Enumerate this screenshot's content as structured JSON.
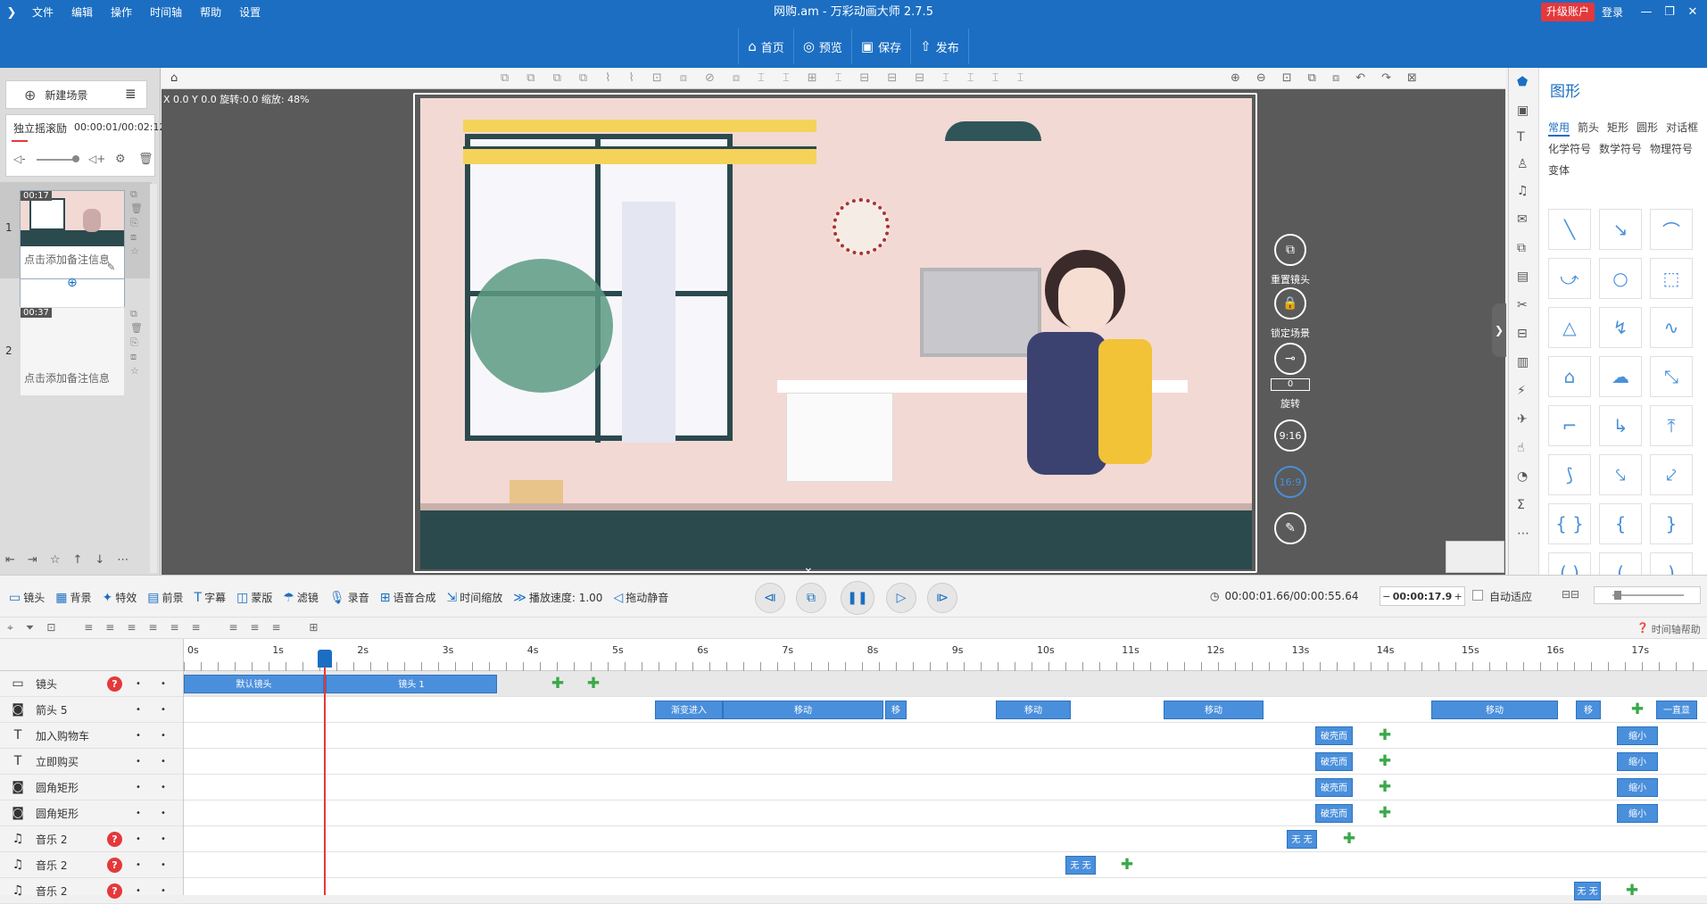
{
  "app": {
    "window_title": "网购.am - 万彩动画大师 2.7.5",
    "menu": [
      "文件",
      "编辑",
      "操作",
      "时间轴",
      "帮助",
      "设置"
    ],
    "upgrade": "升级账户",
    "login": "登录",
    "win_controls": [
      "—",
      "❐",
      "✕"
    ]
  },
  "toolbar": [
    {
      "icon": "⌂",
      "label": "首页"
    },
    {
      "icon": "◎",
      "label": "预览"
    },
    {
      "icon": "▣",
      "label": "保存"
    },
    {
      "icon": "⇧",
      "label": "发布"
    }
  ],
  "left": {
    "new_scene": "新建场景",
    "music_name": "独立摇滚励",
    "music_time": "00:00:01/00:02:12",
    "scenes": [
      {
        "num": "1",
        "time": "00:17",
        "note": "点击添加备注信息"
      },
      {
        "num": "2",
        "time": "00:37",
        "note": "点击添加备注信息"
      }
    ]
  },
  "stage": {
    "coords": "X 0.0 Y 0.0 旋转:0.0 缩放: 48%",
    "controls": [
      {
        "label": "重置镜头"
      },
      {
        "label": "锁定场景"
      },
      {
        "label": "旋转",
        "value": "0"
      },
      {
        "label": "9:16"
      },
      {
        "label": "16:9"
      }
    ]
  },
  "shape_panel": {
    "title": "图形",
    "tabs_row1": [
      "常用",
      "箭头",
      "矩形",
      "圆形",
      "对话框"
    ],
    "tabs_row2": [
      "化学符号",
      "数学符号",
      "物理符号"
    ],
    "tabs_row3": [
      "变体"
    ],
    "active_tab": "常用",
    "shapes": [
      "╲",
      "↘",
      "⌒",
      "⤻",
      "○",
      "⬚",
      "△",
      "↯",
      "∿",
      "⌂",
      "☁",
      "⤡",
      "⌐",
      "↳",
      "⤒",
      "⟆",
      "⤥",
      "⤦",
      "{ }",
      "{",
      "}",
      "( )",
      "(",
      ")"
    ]
  },
  "timeline_toolbar": {
    "items": [
      {
        "icon": "▭",
        "label": "镜头"
      },
      {
        "icon": "▦",
        "label": "背景"
      },
      {
        "icon": "✦",
        "label": "特效"
      },
      {
        "icon": "▤",
        "label": "前景"
      },
      {
        "icon": "T",
        "label": "字幕"
      },
      {
        "icon": "◫",
        "label": "蒙版"
      },
      {
        "icon": "☂",
        "label": "滤镜"
      },
      {
        "icon": "🎙",
        "label": "录音"
      },
      {
        "icon": "⊞",
        "label": "语音合成"
      },
      {
        "icon": "⇲",
        "label": "时间缩放"
      },
      {
        "icon": "≫",
        "label": "播放速度: 1.00"
      },
      {
        "icon": "◁",
        "label": "拖动静音"
      }
    ],
    "time_display": "00:00:01.66/00:00:55.64",
    "time_input": "00:00:17.9",
    "auto_fit": "自动适应",
    "help": "时间轴帮助"
  },
  "ruler": [
    "0s",
    "1s",
    "2s",
    "3s",
    "4s",
    "5s",
    "6s",
    "7s",
    "8s",
    "9s",
    "10s",
    "11s",
    "12s",
    "13s",
    "14s",
    "15s",
    "16s",
    "17s"
  ],
  "tracks": [
    {
      "icon": "▭",
      "name": "镜头",
      "q": true
    },
    {
      "icon": "◙",
      "name": "箭头 5",
      "q": false
    },
    {
      "icon": "T",
      "name": "加入购物车",
      "q": false
    },
    {
      "icon": "T",
      "name": "立即购买",
      "q": false
    },
    {
      "icon": "◙",
      "name": "圆角矩形",
      "q": false
    },
    {
      "icon": "◙",
      "name": "圆角矩形",
      "q": false
    },
    {
      "icon": "♫",
      "name": "音乐 2",
      "q": true
    },
    {
      "icon": "♫",
      "name": "音乐 2",
      "q": true
    },
    {
      "icon": "♫",
      "name": "音乐 2",
      "q": true
    }
  ],
  "clips": {
    "camera": [
      "默认镜头",
      "镜头 1"
    ],
    "arrow": [
      "渐变进入",
      "移动",
      "移",
      "移动",
      "移动",
      "移动",
      "移",
      "一直显"
    ],
    "text1": [
      "破壳而",
      "缩小"
    ],
    "text2": [
      "破壳而",
      "缩小"
    ],
    "rect1": [
      "破壳而",
      "缩小"
    ],
    "rect2": [
      "破壳而",
      "缩小"
    ],
    "music1": [
      "无 无"
    ],
    "music2": [
      "无 无"
    ],
    "music3": [
      "无 无"
    ]
  }
}
